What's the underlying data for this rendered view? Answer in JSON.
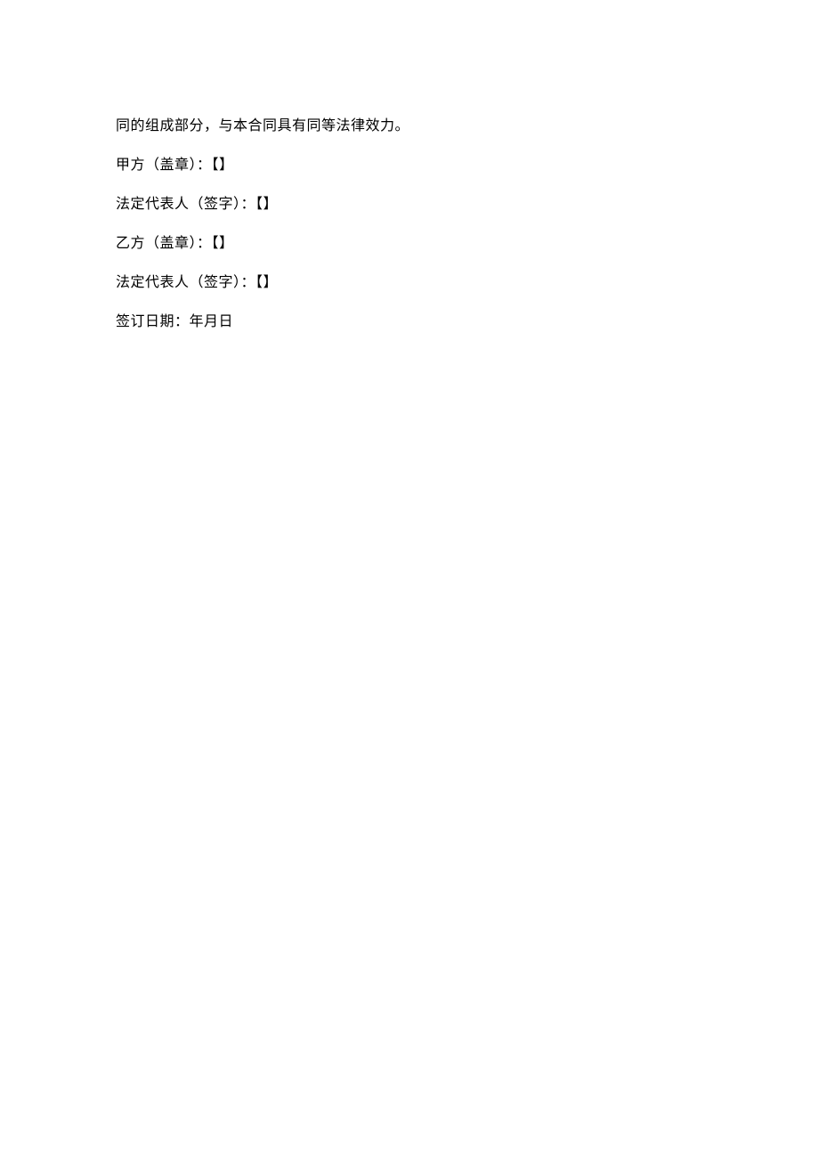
{
  "lines": {
    "l0": "同的组成部分，与本合同具有同等法律效力。",
    "l1": "甲方（盖章）：【】",
    "l2": "法定代表人（签字）：【】",
    "l3": "乙方（盖章）：【】",
    "l4": "法定代表人（签字）：【】",
    "l5": "签订日期：年月日"
  }
}
